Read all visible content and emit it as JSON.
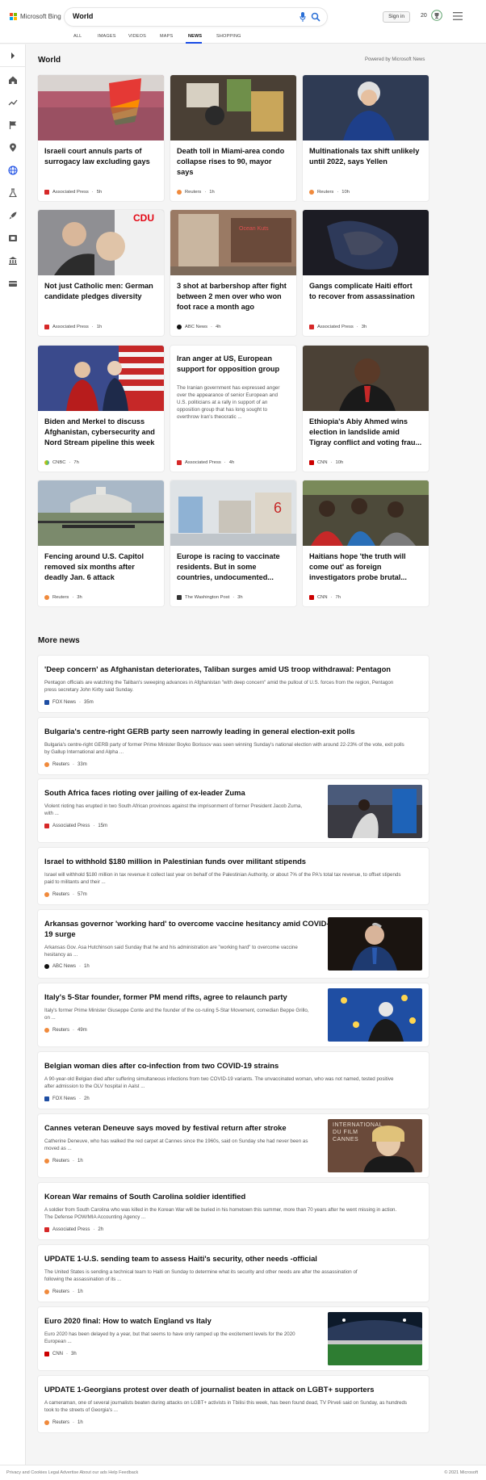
{
  "header": {
    "brand": "Microsoft Bing",
    "query": "World",
    "signin_label": "Sign in",
    "points": "20",
    "tabs": [
      "ALL",
      "IMAGES",
      "VIDEOS",
      "MAPS",
      "NEWS",
      "SHOPPING"
    ],
    "active_tab": "NEWS"
  },
  "rail": {
    "icons": [
      "chevron-right-icon",
      "home-icon",
      "trending-icon",
      "flag-icon",
      "location-pin-icon",
      "globe-icon",
      "science-icon",
      "rocket-icon",
      "film-icon",
      "bank-icon",
      "card-icon"
    ]
  },
  "section": {
    "title": "World",
    "powered_by": "Powered by Microsoft News"
  },
  "cards": [
    {
      "title_l1": "Israeli court annuls parts of",
      "title_l2": "surrogacy law excluding gays",
      "title_l3": "",
      "source": "Associated Press",
      "time": "5h",
      "img_color": "#b25b6e"
    },
    {
      "title_l1": "Death toll in Miami-area condo",
      "title_l2": "collapse rises to 90, mayor",
      "title_l3": "says",
      "source": "Reuters",
      "time": "1h",
      "img_color": "#4a4035"
    },
    {
      "title_l1": "Multinationals tax shift unlikely",
      "title_l2": "until 2022, says Yellen",
      "title_l3": "",
      "source": "Reuters",
      "time": "10h",
      "img_color": "#2f3b54"
    },
    {
      "title_l1": "Not just Catholic men: German",
      "title_l2": "candidate pledges diversity",
      "title_l3": "",
      "source": "Associated Press",
      "time": "1h",
      "img_color": "#8f8f93"
    },
    {
      "title_l1": "3 shot at barbershop after fight",
      "title_l2": "between 2 men over who won",
      "title_l3": "foot race a month ago",
      "source": "ABC News",
      "time": "4h",
      "img_color": "#9a7a64"
    },
    {
      "title_l1": "Gangs complicate Haiti effort",
      "title_l2": "to recover from assassination",
      "title_l3": "",
      "source": "Associated Press",
      "time": "3h",
      "img_color": "#1c1c24"
    },
    {
      "title_l1": "Biden and Merkel to discuss",
      "title_l2": "Afghanistan, cybersecurity and",
      "title_l3": "Nord Stream pipeline this week",
      "source": "CNBC",
      "time": "7h",
      "img_color": "#3a4a8c"
    },
    {
      "title_l1": "Iran anger at US, European",
      "title_l2": "support for opposition group",
      "title_l3": "",
      "source": "Associated Press",
      "time": "4h",
      "snippet_l1": "The Iranian government has expressed anger",
      "snippet_l2": "over the appearance of senior European and",
      "snippet_l3": "U.S. politicians at a rally in support of an",
      "snippet_l4": "opposition group that has long sought to",
      "snippet_l5": "overthrow Iran's theocratic ..."
    },
    {
      "title_l1": "Ethiopia's Abiy Ahmed wins",
      "title_l2": "election in landslide amid",
      "title_l3": "Tigray conflict and voting frau...",
      "source": "CNN",
      "time": "10h",
      "img_color": "#4b4136"
    },
    {
      "title_l1": "Fencing around U.S. Capitol",
      "title_l2": "removed six months after",
      "title_l3": "deadly Jan. 6 attack",
      "source": "Reuters",
      "time": "3h",
      "img_color": "#7b8a6c"
    },
    {
      "title_l1": "Europe is racing to vaccinate",
      "title_l2": "residents. But in some",
      "title_l3": "countries, undocumented...",
      "source": "The Washington Post",
      "time": "3h",
      "img_color": "#c9c4ba"
    },
    {
      "title_l1": "Haitians hope 'the truth will",
      "title_l2": "come out' as foreign",
      "title_l3": "investigators probe brutal...",
      "source": "CNN",
      "time": "7h",
      "img_color": "#4d4a3a"
    }
  ],
  "more_news": {
    "title": "More news",
    "items": [
      {
        "title": "'Deep concern' as Afghanistan deteriorates, Taliban surges amid US troop withdrawal: Pentagon",
        "snippet_l1": "Pentagon officials are watching the Taliban's sweeping advances in Afghanistan \"with deep concern\" amid the pullout of U.S. forces from the region, Pentagon",
        "snippet_l2": "press secretary John Kirby said Sunday.",
        "source": "FOX News",
        "time": "35m"
      },
      {
        "title": "Bulgaria's centre-right GERB party seen narrowly leading in general election-exit polls",
        "snippet_l1": "Bulgaria's centre-right GERB party of former Prime Minister Boyko Borissov was seen winning Sunday's national election with around 22-23% of the vote, exit polls",
        "snippet_l2": "by Gallup International and Alpha ...",
        "source": "Reuters",
        "time": "33m"
      },
      {
        "title": "South Africa faces rioting over jailing of ex-leader Zuma",
        "snippet_l1": "Violent rioting has erupted in two South African provinces against the imprisonment of former President Jacob Zuma,",
        "snippet_l2": "with ...",
        "source": "Associated Press",
        "time": "15m"
      },
      {
        "title": "Israel to withhold $180 million in Palestinian funds over militant stipends",
        "snippet_l1": "Israel will withhold $180 million in tax revenue it collect last year on behalf of the Palestinian Authority, or about 7% of the PA's total tax revenue, to offset stipends",
        "snippet_l2": "paid to militants and their ...",
        "source": "Reuters",
        "time": "57m"
      },
      {
        "title": "Arkansas governor 'working hard' to overcome vaccine hesitancy amid COVID-",
        "title_l2": "19 surge",
        "snippet_l1": "Arkansas Gov. Asa Hutchinson said Sunday that he and his administration are \"working hard\" to overcome vaccine",
        "snippet_l2": "hesitancy as ...",
        "source": "ABC News",
        "time": "1h"
      },
      {
        "title": "Italy's 5-Star founder, former PM mend rifts, agree to relaunch party",
        "snippet_l1": "Italy's former Prime Minister Giuseppe Conte and the founder of the co-ruling 5-Star Movement, comedian Beppe Grillo,",
        "snippet_l2": "on ...",
        "source": "Reuters",
        "time": "49m"
      },
      {
        "title": "Belgian woman dies after co-infection from two COVID-19 strains",
        "snippet_l1": "A 90-year-old Belgian died after suffering simultaneous infections from two COVID-19 variants.  The unvaccinated woman, who was not named, tested positive",
        "snippet_l2": "after admission to the OLV hospital in Aalst ...",
        "source": "FOX News",
        "time": "2h"
      },
      {
        "title": "Cannes veteran Deneuve says moved by festival return after stroke",
        "snippet_l1": "Catherine Deneuve, who has walked the red carpet at Cannes since the 1960s, said on Sunday she had never been as",
        "snippet_l2": "moved as ...",
        "source": "Reuters",
        "time": "1h",
        "thumb_text_l1": "INTERNATIONAL",
        "thumb_text_l2": "DU FILM",
        "thumb_text_l3": "CANNES"
      },
      {
        "title": "Korean War remains of South Carolina soldier identified",
        "snippet_l1": "A soldier from South Carolina who was killed in the Korean War will be buried in his hometown this summer, more than 70 years after he went missing in action.",
        "snippet_l2": "The Defense POW/MIA Accounting Agency ...",
        "source": "Associated Press",
        "time": "2h"
      },
      {
        "title": "UPDATE 1-U.S. sending team to assess Haiti's security, other needs -official",
        "snippet_l1": "The United States is sending a technical team to Haiti on Sunday to determine what its security and other needs are after the assassination of",
        "snippet_l2": "following the assassination of its ...",
        "source": "Reuters",
        "time": "1h"
      },
      {
        "title": "Euro 2020 final: How to watch England vs Italy",
        "snippet_l1": "Euro 2020 has been delayed by a year, but that seems to have only ramped up the excitement levels for the 2020",
        "snippet_l2": "European ...",
        "source": "CNN",
        "time": "3h"
      },
      {
        "title": "UPDATE 1-Georgians protest over death of journalist beaten in attack on LGBT+ supporters",
        "snippet_l1": "A cameraman, one of several journalists beaten during attacks on LGBT+ activists in Tbilisi this week, has been found dead, TV Pirveli said on Sunday, as hundreds",
        "snippet_l2": "took to the streets of Georgia's ...",
        "source": "Reuters",
        "time": "1h"
      }
    ]
  },
  "footer": {
    "links": "Privacy and Cookies    Legal    Advertise    About our ads    Help    Feedback",
    "copyright": "© 2021 Microsoft"
  },
  "colors": {
    "accent": "#174ae4",
    "ap": "#d62828",
    "reuters": "#f08a3c",
    "cnn": "#cc0000",
    "fox": "#1f4ea3"
  }
}
